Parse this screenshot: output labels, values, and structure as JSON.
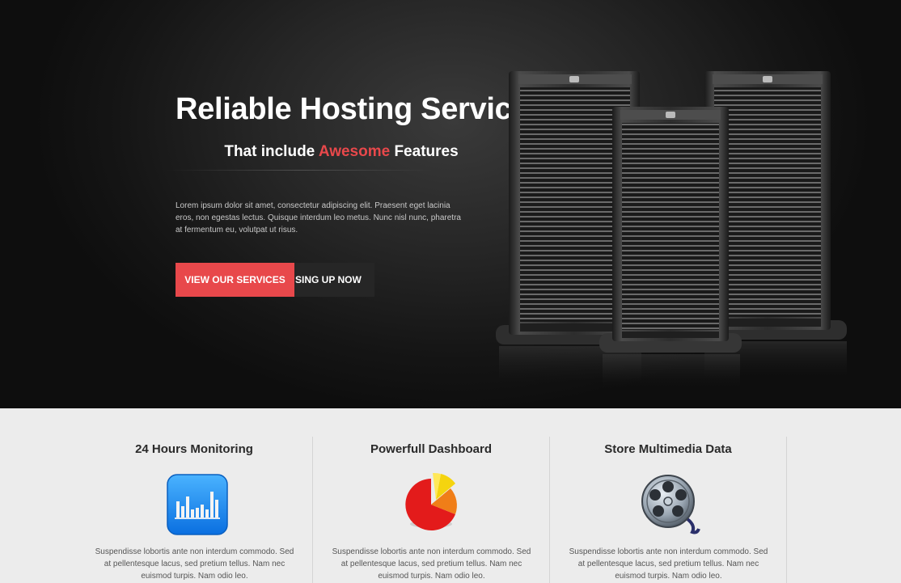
{
  "hero": {
    "title": "Reliable Hosting Services",
    "subtitle_before": "That include ",
    "subtitle_accent": "Awesome",
    "subtitle_after": " Features",
    "body": "Lorem ipsum dolor sit amet, consectetur adipiscing elit. Praesent eget lacinia eros, non egestas lectus. Quisque interdum leo metus. Nunc nisl nunc, pharetra at fermentum eu, volutpat ut risus.",
    "primary_button": "VIEW OUR SERVICES",
    "secondary_button": "SING UP NOW"
  },
  "colors": {
    "accent": "#e8484b",
    "hero_bg": "#1a1a1a",
    "features_bg": "#ececec"
  },
  "features": [
    {
      "title": "24 Hours Monitoring",
      "icon": "bar-chart-app-icon",
      "text": "Suspendisse lobortis ante non interdum commodo. Sed at pellentesque lacus, sed pretium tellus. Nam nec euismod turpis. Nam odio leo."
    },
    {
      "title": "Powerfull Dashboard",
      "icon": "pie-chart-icon",
      "text": "Suspendisse lobortis ante non interdum commodo. Sed at pellentesque lacus, sed pretium tellus. Nam nec euismod turpis. Nam odio leo."
    },
    {
      "title": "Store Multimedia Data",
      "icon": "film-reel-icon",
      "text": "Suspendisse lobortis ante non interdum commodo. Sed at pellentesque lacus, sed pretium tellus. Nam nec euismod turpis. Nam odio leo."
    }
  ]
}
